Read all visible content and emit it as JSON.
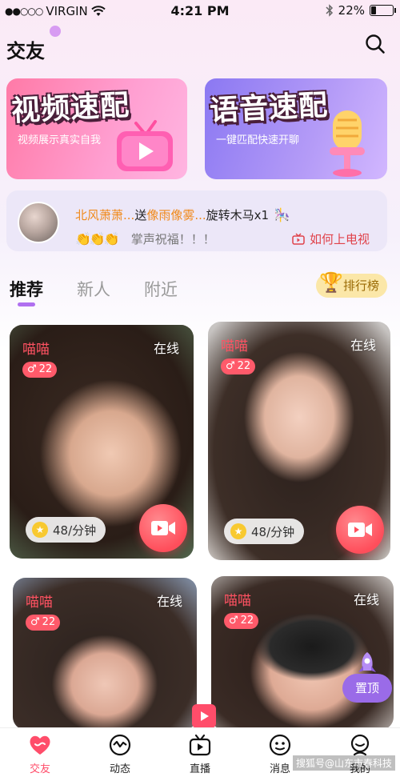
{
  "status_bar": {
    "carrier": "VIRGIN",
    "time": "4:21 PM",
    "battery": "22%",
    "battery_level": 0.22
  },
  "header": {
    "title": "交友"
  },
  "banners": [
    {
      "title": "视频速配",
      "subtitle": "视频展示真实自我",
      "icon": "tv-play-icon"
    },
    {
      "title": "语音速配",
      "subtitle": "一键匹配快速开聊",
      "icon": "microphone-icon"
    }
  ],
  "ticker": {
    "sender": "北风萧萧...",
    "verb": "送",
    "receiver": "像雨像雾...",
    "gift": "旋转木马x1",
    "claps": "👏👏👏",
    "blessing": "掌声祝福！！！",
    "tv_link": "如何上电视"
  },
  "tabs": [
    {
      "label": "推荐",
      "active": true
    },
    {
      "label": "新人",
      "active": false
    },
    {
      "label": "附近",
      "active": false
    }
  ],
  "rank_button": "排行榜",
  "cards": [
    {
      "name": "喵喵",
      "status": "在线",
      "age": "22",
      "price": "48/分钟"
    },
    {
      "name": "喵喵",
      "status": "在线",
      "age": "22",
      "price": "48/分钟"
    },
    {
      "name": "喵喵",
      "status": "在线",
      "age": "22"
    },
    {
      "name": "喵喵",
      "status": "在线",
      "age": "22"
    }
  ],
  "float_top": "置顶",
  "bottom_nav": [
    {
      "label": "交友",
      "icon": "heart-icon",
      "active": true
    },
    {
      "label": "动态",
      "icon": "activity-icon",
      "active": false
    },
    {
      "label": "直播",
      "icon": "live-tv-icon",
      "active": false
    },
    {
      "label": "消息",
      "icon": "chat-face-icon",
      "active": false
    },
    {
      "label": "我的",
      "icon": "profile-icon",
      "active": false
    }
  ],
  "watermark": "搜狐号@山东市春科技",
  "colors": {
    "accent": "#ff4d6a",
    "tab_indicator": "#b070f0",
    "name_red": "#ff5262"
  }
}
